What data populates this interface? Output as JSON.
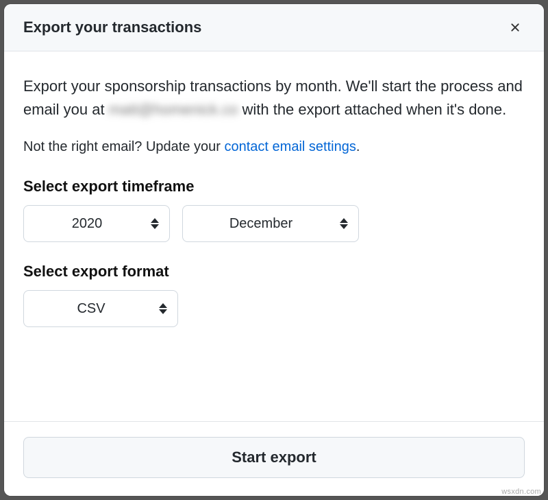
{
  "dialog": {
    "title": "Export your transactions",
    "intro_before": "Export your sponsorship transactions by month. We'll start the process and email you at ",
    "email_blurred": "matt@homenick.co",
    "intro_after": " with the export attached when it's done.",
    "email_note": "Not the right email? Update your ",
    "email_link_text": "contact email settings",
    "email_note_suffix": ".",
    "timeframe_label": "Select export timeframe",
    "format_label": "Select export format",
    "year_selected": "2020",
    "month_selected": "December",
    "format_selected": "CSV",
    "start_button": "Start export"
  },
  "watermark": "wsxdn.com"
}
